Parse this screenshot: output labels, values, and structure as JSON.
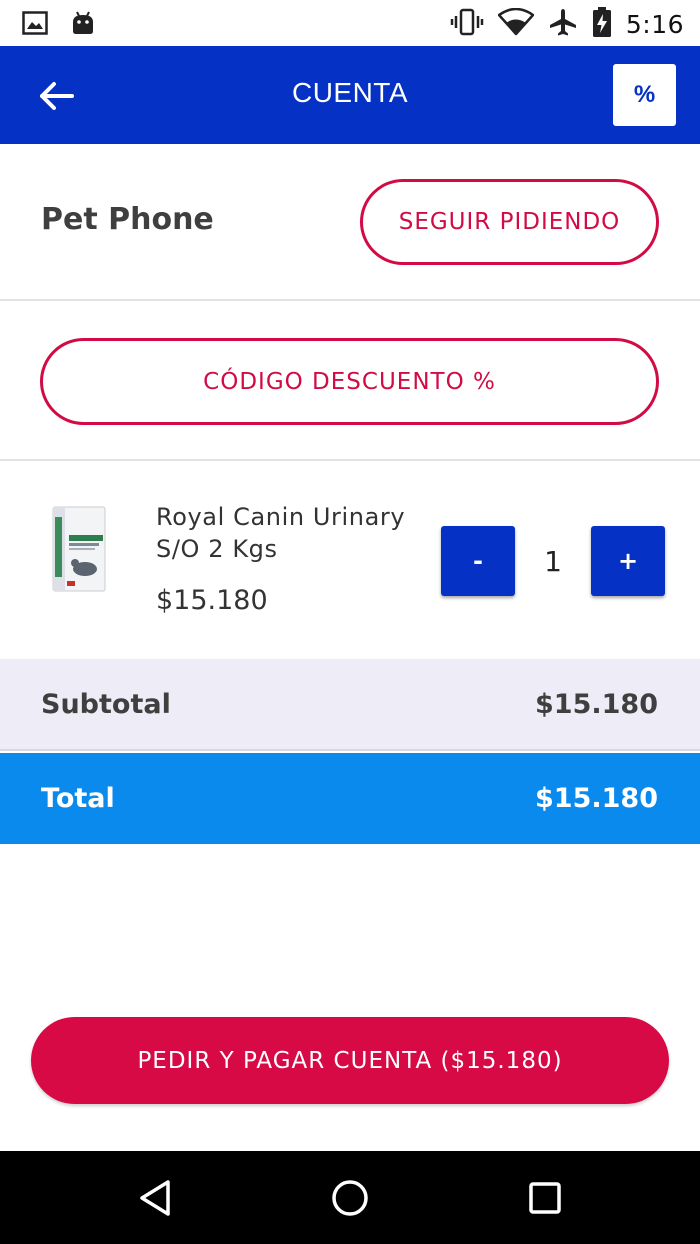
{
  "status_bar": {
    "time": "5:16",
    "icons": [
      "image-notification-icon",
      "android-notification-icon",
      "vibrate-icon",
      "wifi-icon",
      "airplane-mode-icon",
      "battery-charging-icon"
    ]
  },
  "app_bar": {
    "title": "CUENTA",
    "back_icon": "arrow-left-icon",
    "percent_label": "%"
  },
  "store": {
    "name": "Pet Phone",
    "keep_ordering_label": "SEGUIR PIDIENDO"
  },
  "discount": {
    "label": "CÓDIGO DESCUENTO %"
  },
  "cart": {
    "items": [
      {
        "name": "Royal Canin Urinary S/O 2 Kgs",
        "price": "$15.180",
        "quantity": "1",
        "minus_label": "-",
        "plus_label": "+"
      }
    ]
  },
  "summary": {
    "subtotal_label": "Subtotal",
    "subtotal_value": "$15.180",
    "total_label": "Total",
    "total_value": "$15.180"
  },
  "checkout": {
    "label": "PEDIR Y PAGAR CUENTA ($15.180)"
  },
  "colors": {
    "primary_blue": "#0532c4",
    "total_blue": "#0a8aed",
    "accent_red": "#d80a45",
    "subtotal_bg": "#eeedf7"
  },
  "nav_bar": {
    "icons": [
      "nav-back-icon",
      "nav-home-icon",
      "nav-recents-icon"
    ]
  }
}
